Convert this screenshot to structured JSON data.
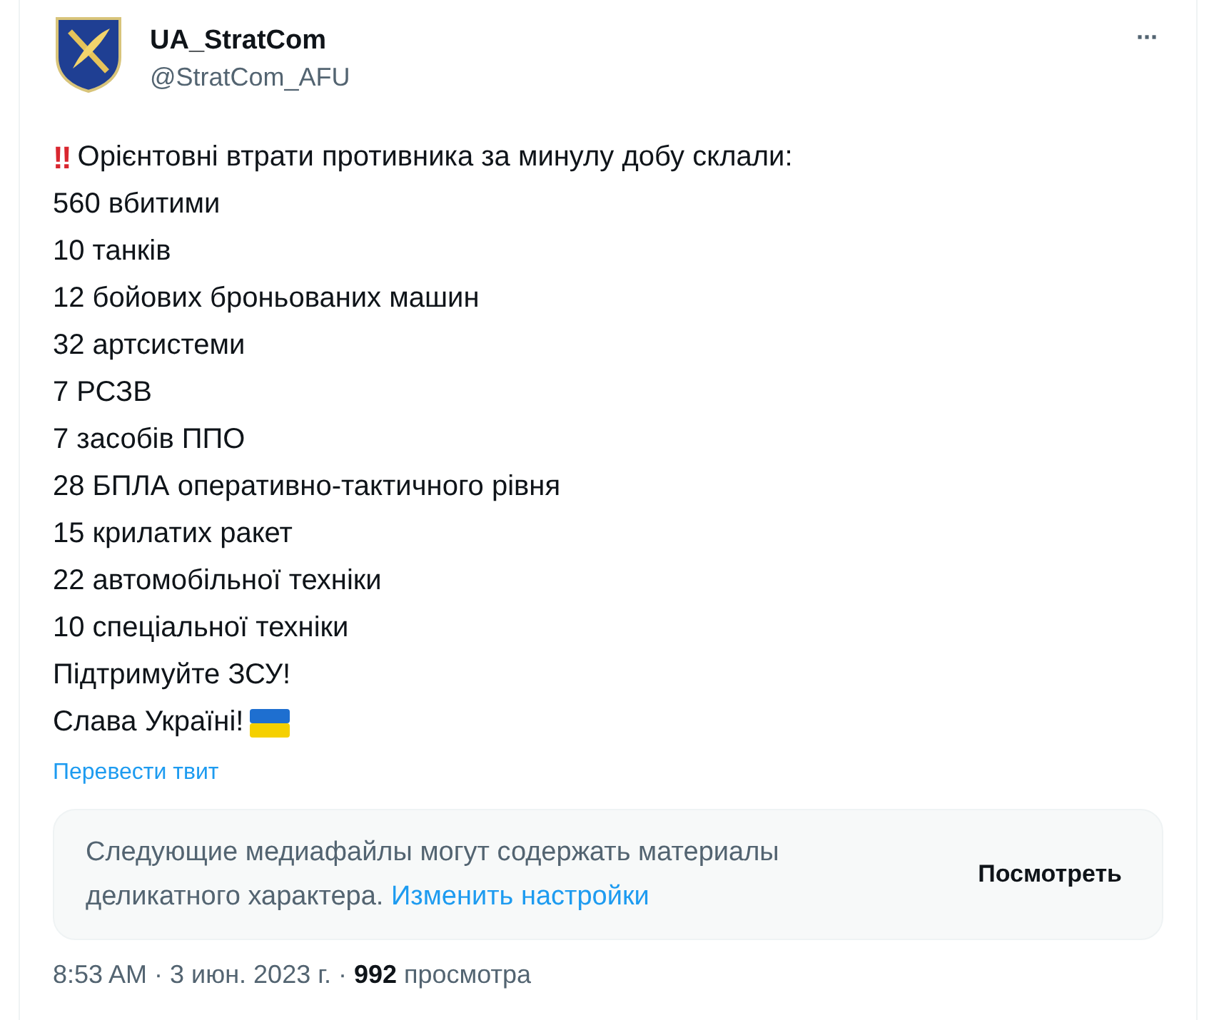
{
  "author": {
    "name": "UA_StratCom",
    "handle": "@StratCom_AFU"
  },
  "more_button": "···",
  "tweet": {
    "alert_mark": "‼",
    "lines": [
      "Орієнтовні втрати противника за минулу добу склали:",
      "560 вбитими",
      "10 танків",
      "12 бойових броньованих машин",
      "32 артсистеми",
      "7 РСЗВ",
      "7 засобів ППО",
      "28 БПЛА оперативно-тактичного рівня",
      "15 крилатих ракет",
      "22 автомобільної техніки",
      "10 спеціальної техніки",
      "Підтримуйте ЗСУ!",
      "Слава Україні!"
    ]
  },
  "translate_link": "Перевести твит",
  "sensitive_notice": {
    "text": "Следующие медиафайлы могут содержать материалы деликатного характера.",
    "link": "Изменить настройки",
    "button": "Посмотреть"
  },
  "meta": "8:53 AM · 3 июн. 2023 г. · **992** просмотра"
}
